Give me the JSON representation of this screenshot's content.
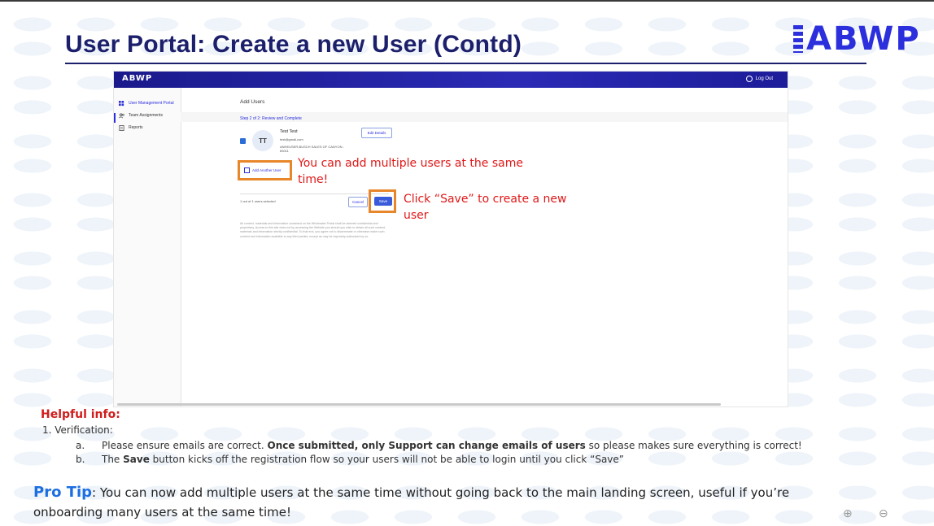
{
  "slide": {
    "title": "User Portal: Create a new User (Contd)",
    "brand": "ABWP"
  },
  "app": {
    "brand": "ABWP",
    "logout_label": "Log Out",
    "sidebar": [
      {
        "label": "User Management Portal",
        "icon": "grid-icon"
      },
      {
        "label": "Team Assignments",
        "icon": "users-icon"
      },
      {
        "label": "Reports",
        "icon": "document-icon"
      }
    ],
    "page_title": "Add Users",
    "step": "Step 2 of 2: Review and Complete",
    "user": {
      "initials": "TT",
      "name": "Test Test",
      "email": "test@gmail.com",
      "org": "ANHEUSER-BUSCH SALES OF CANYON - 83011"
    },
    "edit_details": "Edit Details",
    "add_another": "Add Another User",
    "selected": "1 out of 1 users selected",
    "cancel": "Cancel",
    "save": "Save",
    "disclaimer": "All content, materials and information contained on the Wholesaler Portal shall be deemed confidential and proprietary. Access to this site does not by accessing the Website you should you wish to obtain all such content, materials and information strictly confidential. To that end, you agree not to disseminate or otherwise make such content and information available to any third parties, except as may be expressly authorized by us."
  },
  "callouts": {
    "add_multiple": "You can add multiple users at the same time!",
    "save_hint": "Click “Save” to create a new user"
  },
  "helpful": {
    "title": "Helpful info:",
    "item1": "1.   Verification:",
    "a_letter": "a.",
    "a_pre": "Please ensure emails are correct. ",
    "a_bold": "Once submitted, only Support can change emails of users",
    "a_post": " so please makes sure everything is correct!",
    "b_letter": "b.",
    "b_pre": "The ",
    "b_bold": "Save",
    "b_post": " button kicks off the registration flow so your users will not be able to login until you click “Save”"
  },
  "protip": {
    "lead": "Pro Tip",
    "text": ": You can now add multiple users at the same time without going back to the main landing screen, useful if you’re onboarding many users at the same time!"
  },
  "zoom": {
    "in": "⊕",
    "out": "⊖"
  }
}
